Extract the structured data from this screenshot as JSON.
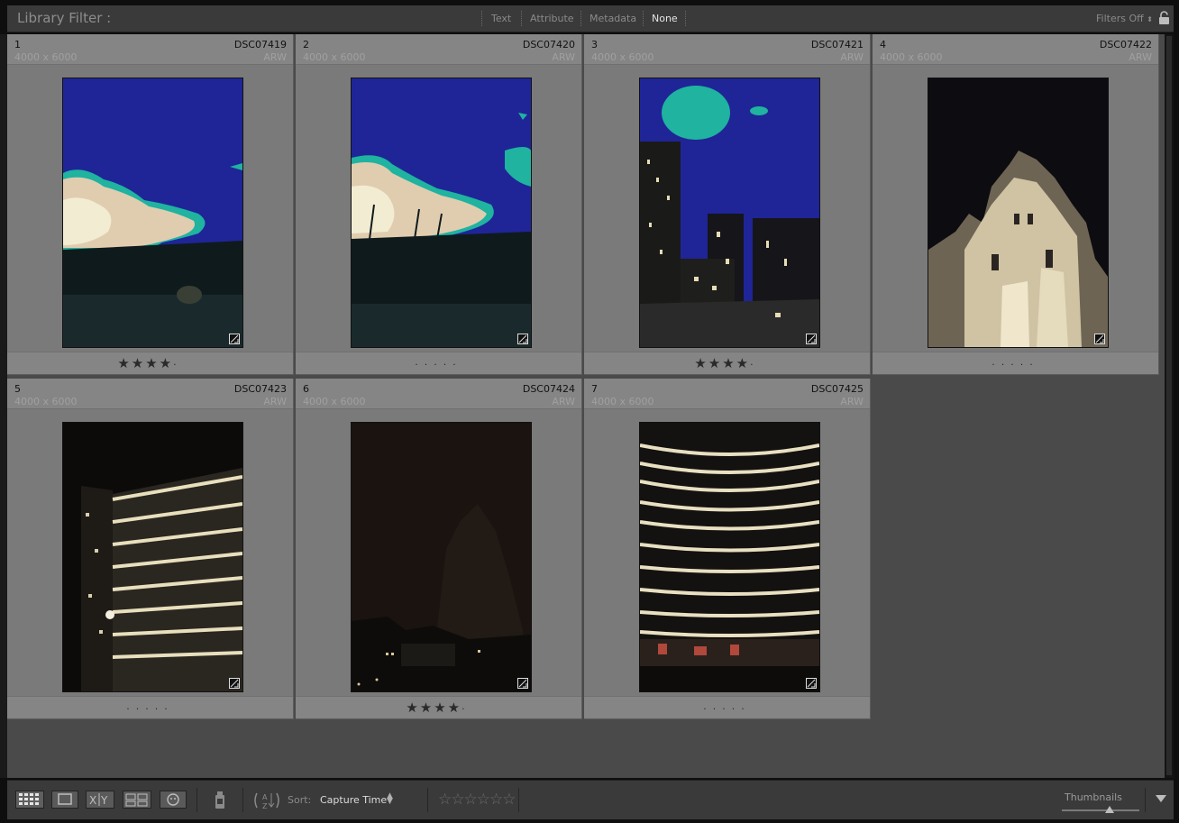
{
  "filter_bar": {
    "title": "Library Filter :",
    "tabs": [
      "Text",
      "Attribute",
      "Metadata",
      "None"
    ],
    "active_tab": "None",
    "filters_status": "Filters Off"
  },
  "photos": [
    {
      "index": "1",
      "name": "DSC07419",
      "dims": "4000 x 6000",
      "ext": "ARW",
      "stars": 4,
      "scene": "clouds-blue-sky"
    },
    {
      "index": "2",
      "name": "DSC07420",
      "dims": "4000 x 6000",
      "ext": "ARW",
      "stars": 0,
      "scene": "clouds-trees"
    },
    {
      "index": "3",
      "name": "DSC07421",
      "dims": "4000 x 6000",
      "ext": "ARW",
      "stars": 4,
      "scene": "city-towers"
    },
    {
      "index": "4",
      "name": "DSC07422",
      "dims": "4000 x 6000",
      "ext": "ARW",
      "stars": 0,
      "scene": "stone-tower"
    },
    {
      "index": "5",
      "name": "DSC07423",
      "dims": "4000 x 6000",
      "ext": "ARW",
      "stars": 0,
      "scene": "night-building"
    },
    {
      "index": "6",
      "name": "DSC07424",
      "dims": "4000 x 6000",
      "ext": "ARW",
      "stars": 4,
      "scene": "night-tree"
    },
    {
      "index": "7",
      "name": "DSC07425",
      "dims": "4000 x 6000",
      "ext": "ARW",
      "stars": 0,
      "scene": "curved-facade"
    }
  ],
  "toolbar": {
    "view_modes": [
      "grid-view-icon",
      "loupe-view-icon",
      "compare-view-icon",
      "survey-view-icon",
      "people-view-icon"
    ],
    "sort_label": "Sort:",
    "sort_value": "Capture Time",
    "thumbnails_label": "Thumbnails"
  },
  "colors": {
    "cell_bg": "#7a7a7a",
    "grid_bg": "#4a4a4a",
    "active_tab": "#e4e4e4"
  }
}
